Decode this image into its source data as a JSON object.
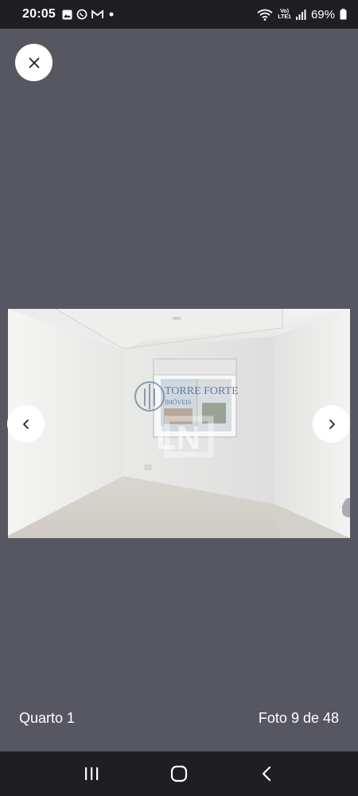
{
  "status_bar": {
    "time": "20:05",
    "left_icons": [
      "gallery-icon",
      "whatsapp-icon",
      "gmail-icon",
      "notification-dot-icon"
    ],
    "volte_top": "Vo)",
    "volte_bottom": "LTE1",
    "battery_percent": "69%"
  },
  "viewer": {
    "close_icon": "close-icon",
    "prev_icon": "chevron-left-icon",
    "next_icon": "chevron-right-icon",
    "watermark_brand": "TORRE FORTE",
    "watermark_sub": "IMÓVEIS",
    "watermark_tagline": "LN"
  },
  "caption": {
    "room": "Quarto 1",
    "counter": "Foto 9 de 48"
  },
  "colors": {
    "background": "#575761",
    "system_bars": "#1f1f23",
    "button_bg": "#ffffff"
  }
}
